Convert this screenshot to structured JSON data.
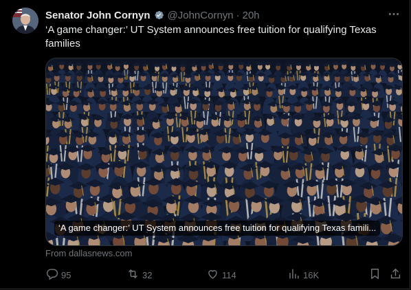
{
  "author": {
    "name": "Senator John Cornyn",
    "handle": "@JohnCornyn",
    "separator": "·",
    "time": "20h"
  },
  "tweet": {
    "text": "‘A game changer:’ UT System announces free tuition for qualifying Texas families"
  },
  "card": {
    "caption": "‘A game changer:’ UT System announces free tuition for qualifying Texas famili...",
    "source": "From dallasnews.com"
  },
  "actions": {
    "replies": "95",
    "reposts": "32",
    "likes": "114",
    "views": "16K"
  },
  "colors": {
    "background": "#000000",
    "text": "#e7e9ea",
    "muted": "#71767b",
    "verified": "#829aab",
    "gown": "#1c2a4a"
  },
  "icons": [
    "verified-badge-icon",
    "more-icon",
    "reply-icon",
    "repost-icon",
    "like-icon",
    "views-icon",
    "bookmark-icon",
    "share-icon"
  ]
}
